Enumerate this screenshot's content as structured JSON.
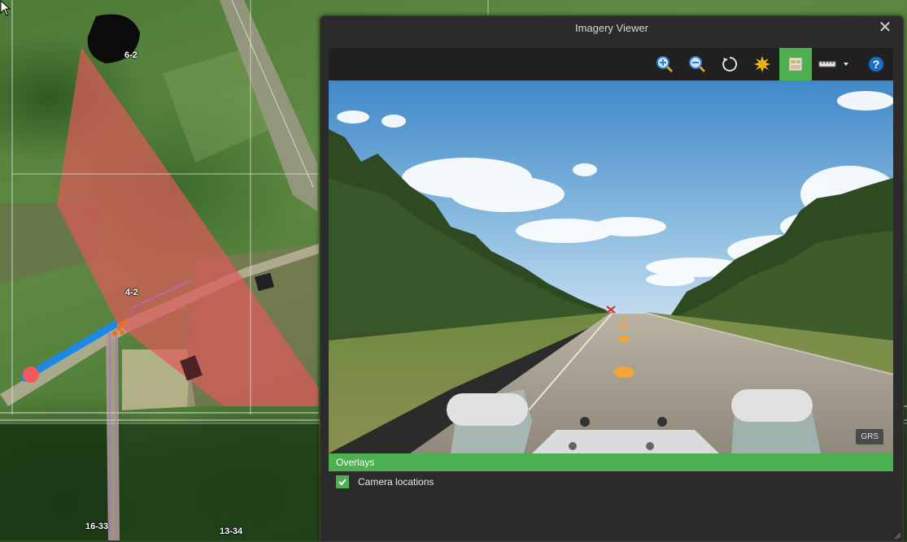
{
  "map": {
    "labels": {
      "lsd_6_2": "6-2",
      "lsd_4_2": "4-2",
      "lsd_16_33": "16-33",
      "lsd_13_34": "13-34"
    }
  },
  "viewer": {
    "title": "Imagery Viewer",
    "close_label": "✕",
    "toolbar": {
      "zoom_in": "zoom-in-icon",
      "zoom_out": "zoom-out-icon",
      "reset": "rotate-reset-icon",
      "brightness": "brightness-icon",
      "overlay_toggle": "overlay-icon",
      "measure": "measure-icon",
      "help": "help-icon"
    },
    "badge": "GRS",
    "overlays": {
      "header": "Overlays",
      "items": [
        {
          "label": "Camera locations",
          "checked": true
        }
      ]
    }
  },
  "colors": {
    "accent": "#4caf50",
    "view_cone": "#e05a5a",
    "camera_track": "#1e88e5",
    "camera_marker": "#f2a33a"
  }
}
